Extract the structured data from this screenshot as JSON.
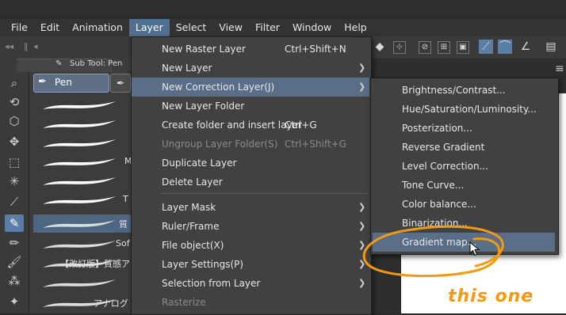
{
  "menubar": {
    "items": [
      "File",
      "Edit",
      "Animation",
      "Layer",
      "Select",
      "View",
      "Filter",
      "Window",
      "Help"
    ],
    "active": "Layer"
  },
  "subtool": {
    "tab_label": "Sub Tool: Pen",
    "group_label": "Pen",
    "brushes": [
      {
        "name": ""
      },
      {
        "name": ""
      },
      {
        "name": ""
      },
      {
        "name": "M"
      },
      {
        "name": ""
      },
      {
        "name": "T"
      },
      {
        "name": "質"
      },
      {
        "name": "Sof"
      },
      {
        "name": "【改訂版】質感ア"
      },
      {
        "name": ""
      },
      {
        "name": "アナログ"
      }
    ]
  },
  "layer_menu": {
    "items": [
      {
        "label": "New Raster Layer",
        "shortcut": "Ctrl+Shift+N",
        "submenu": false,
        "disabled": false
      },
      {
        "label": "New Layer",
        "shortcut": "",
        "submenu": true,
        "disabled": false
      },
      {
        "label": "New Correction Layer(J)",
        "shortcut": "",
        "submenu": true,
        "disabled": false,
        "highlighted": true
      },
      {
        "label": "New Layer Folder",
        "shortcut": "",
        "submenu": false,
        "disabled": false
      },
      {
        "label": "Create folder and insert layer",
        "shortcut": "Ctrl+G",
        "submenu": false,
        "disabled": false
      },
      {
        "label": "Ungroup Layer Folder(S)",
        "shortcut": "Ctrl+Shift+G",
        "submenu": false,
        "disabled": true
      },
      {
        "label": "Duplicate Layer",
        "shortcut": "",
        "submenu": false,
        "disabled": false
      },
      {
        "label": "Delete Layer",
        "shortcut": "",
        "submenu": false,
        "disabled": false
      },
      {
        "label": "Layer Mask",
        "shortcut": "",
        "submenu": true,
        "disabled": false
      },
      {
        "label": "Ruler/Frame",
        "shortcut": "",
        "submenu": true,
        "disabled": false
      },
      {
        "label": "File object(X)",
        "shortcut": "",
        "submenu": true,
        "disabled": false
      },
      {
        "label": "Layer Settings(P)",
        "shortcut": "",
        "submenu": true,
        "disabled": false
      },
      {
        "label": "Selection from Layer",
        "shortcut": "",
        "submenu": true,
        "disabled": false
      },
      {
        "label": "Rasterize",
        "shortcut": "",
        "submenu": false,
        "disabled": true
      }
    ]
  },
  "correction_menu": {
    "items": [
      {
        "label": "Brightness/Contrast..."
      },
      {
        "label": "Hue/Saturation/Luminosity..."
      },
      {
        "label": "Posterization..."
      },
      {
        "label": "Reverse Gradient"
      },
      {
        "label": "Level Correction..."
      },
      {
        "label": "Tone Curve..."
      },
      {
        "label": "Color balance..."
      },
      {
        "label": "Binarization..."
      },
      {
        "label": "Gradient map...",
        "highlighted": true
      }
    ]
  },
  "annotation": {
    "text": "this one",
    "color": "#f29a12"
  },
  "colors": {
    "menu_bg": "#414141",
    "highlight": "#5a6e88",
    "menubar_active": "#4f6f93"
  }
}
